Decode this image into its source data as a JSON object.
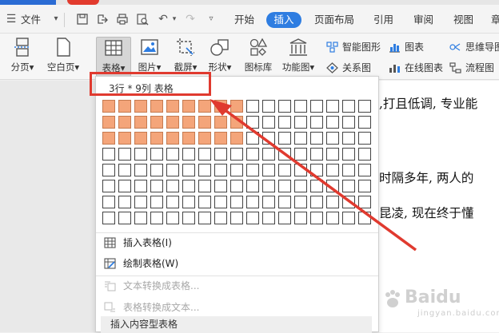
{
  "menubar": {
    "file_label": "文件",
    "tabs": [
      "开始",
      "插入",
      "页面布局",
      "引用",
      "审阅",
      "视图",
      "章"
    ],
    "active_tab": "插入"
  },
  "ribbon": {
    "page_break": "分页",
    "blank_page": "空白页",
    "table": "表格",
    "picture": "图片",
    "screenshot": "截屏",
    "shapes": "形状",
    "icon_library": "图标库",
    "function_chart": "功能图",
    "smart_graphic": "智能图形",
    "chart": "图表",
    "mind_map": "思维导图",
    "relation_chart": "关系图",
    "online_chart": "在线图表",
    "flowchart": "流程图"
  },
  "table_dropdown": {
    "grid_caption": "3行 * 9列 表格",
    "rows_total": 8,
    "cols_total": 17,
    "selected_rows": 3,
    "selected_cols": 9,
    "items": [
      {
        "label": "插入表格(I)",
        "enabled": true
      },
      {
        "label": "绘制表格(W)",
        "enabled": true
      },
      {
        "label": "文本转换成表格...",
        "enabled": false
      },
      {
        "label": "表格转换成文本...",
        "enabled": false
      }
    ],
    "footer_label": "插入内容型表格"
  },
  "document": {
    "lines": [
      ",打且低调, 专业能",
      "时隔多年, 两人的",
      "昆凌, 现在终于懂"
    ]
  },
  "watermark": {
    "brand": "Baidu",
    "sub": "jingyan.baidu.com"
  },
  "colors": {
    "accent": "#2e7de1",
    "selected_cell": "#f4a57a",
    "highlight": "#e03a2f"
  }
}
